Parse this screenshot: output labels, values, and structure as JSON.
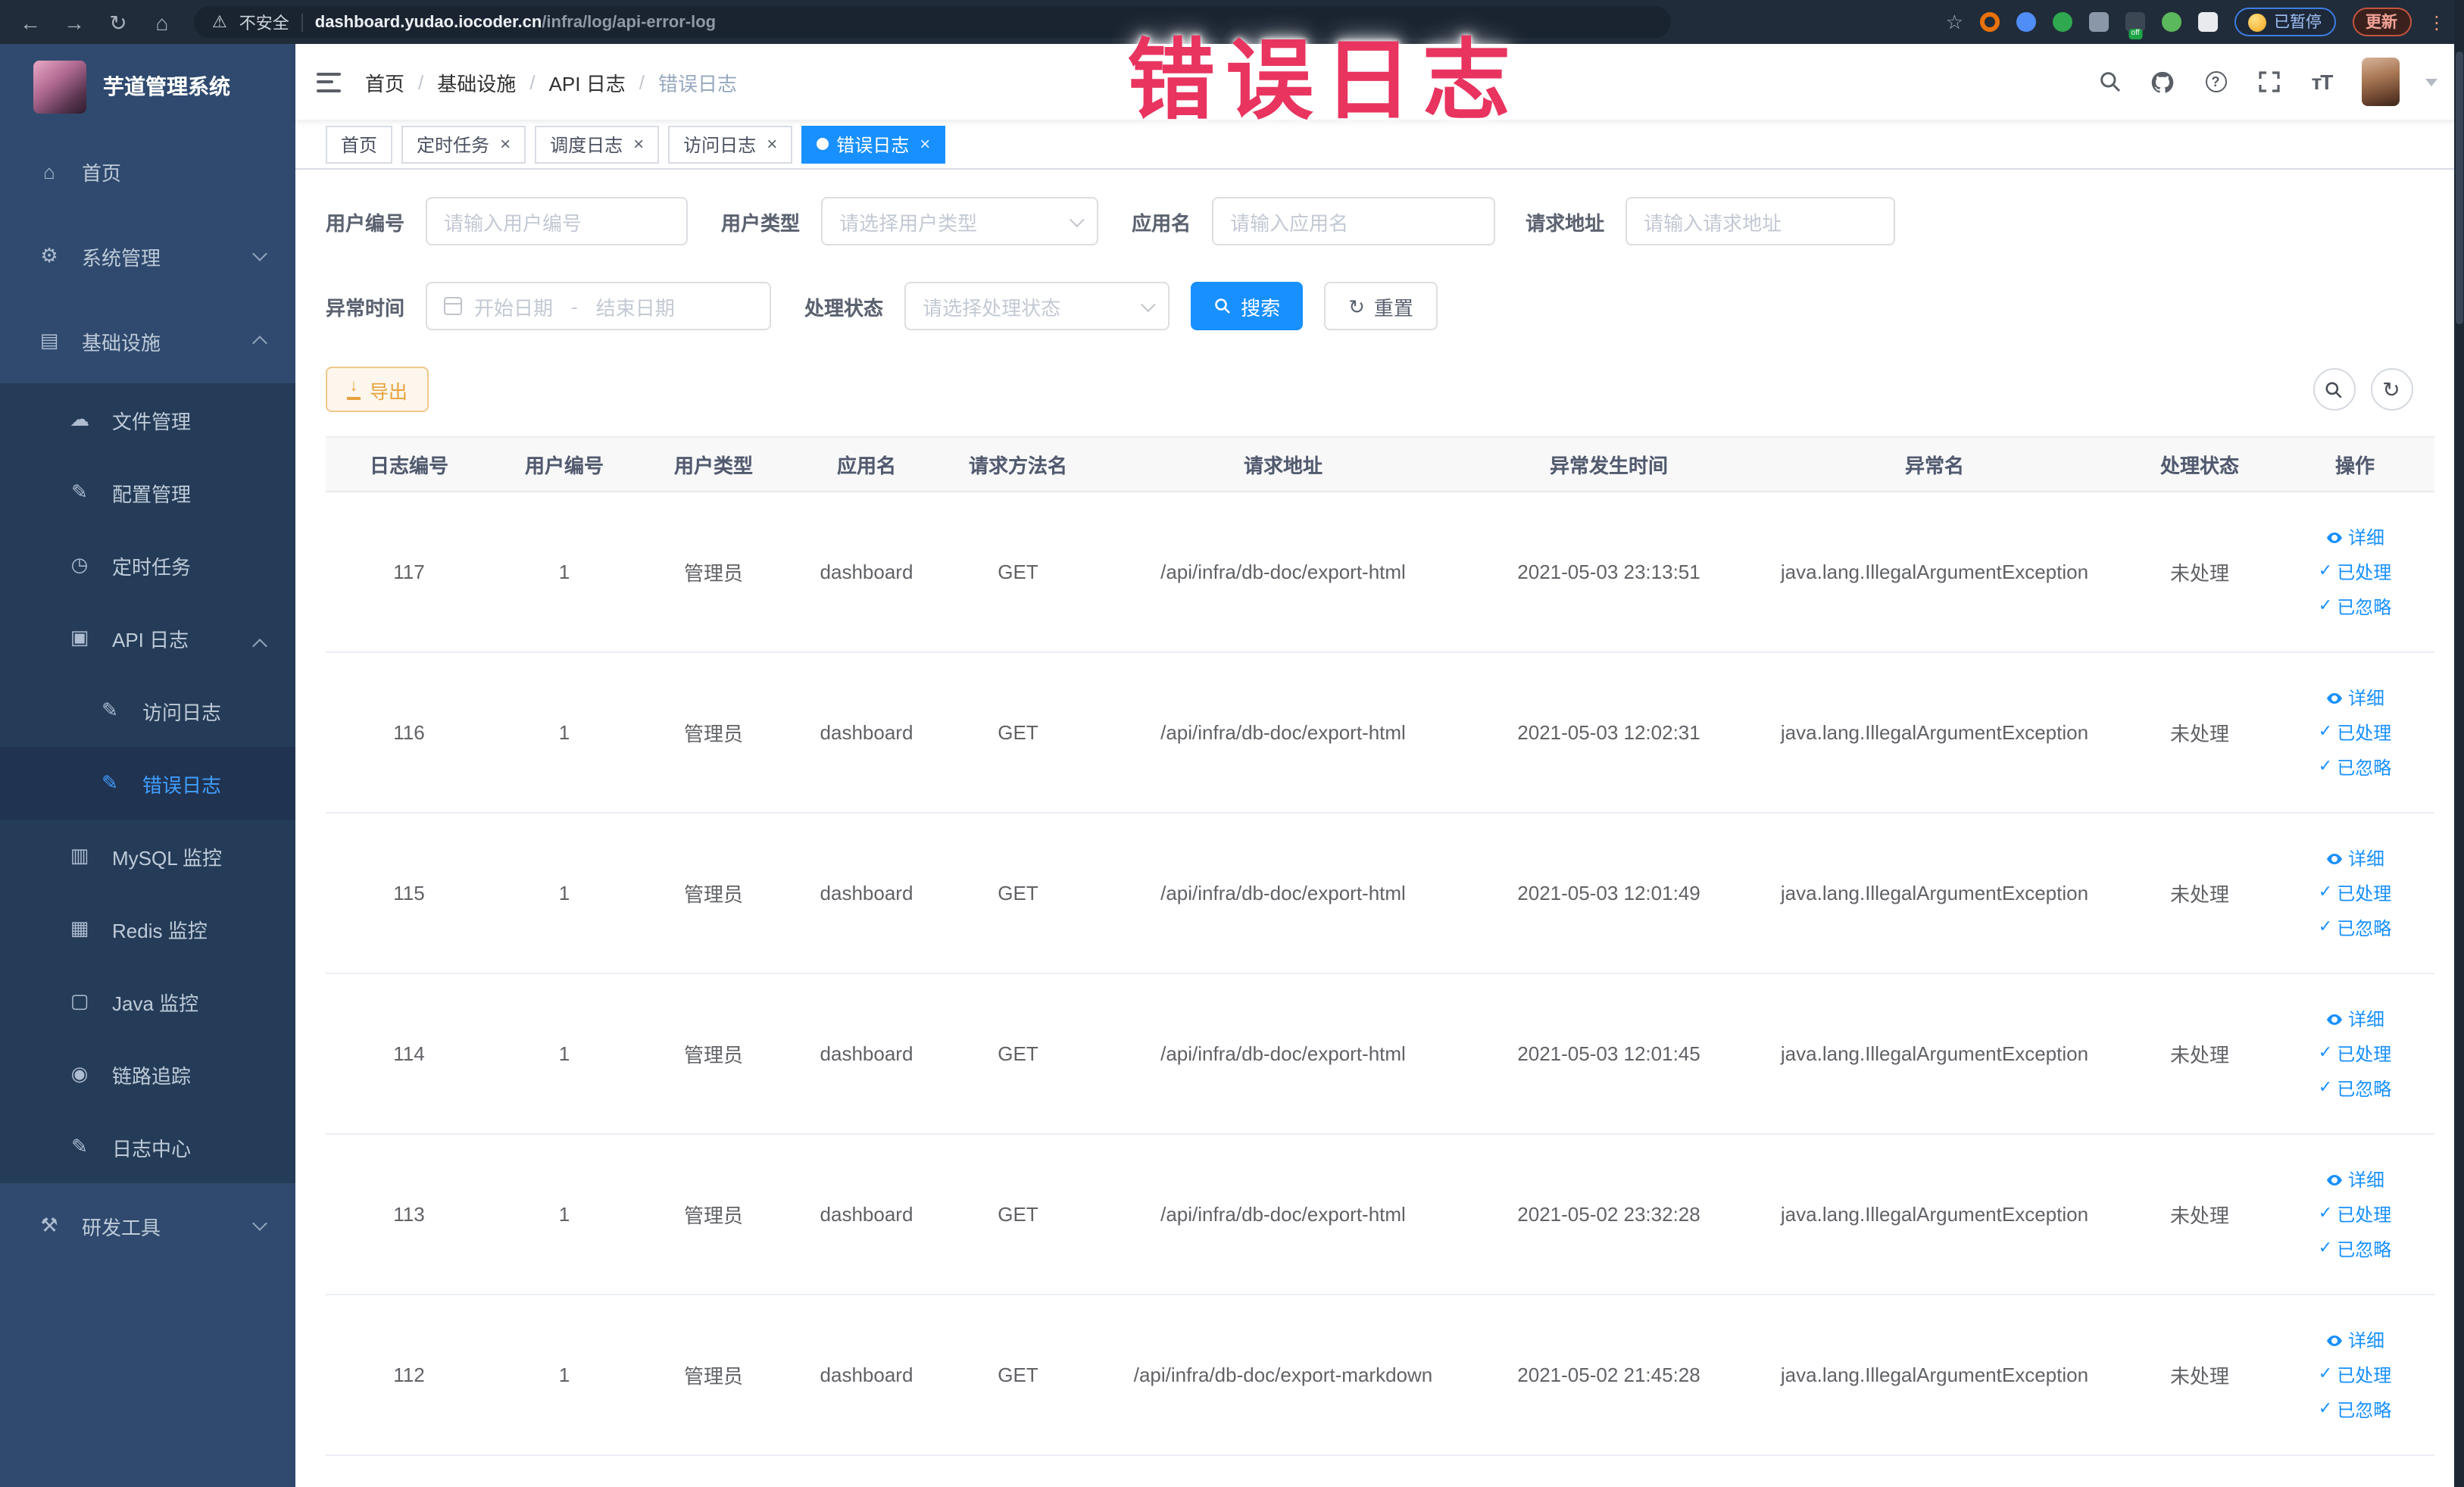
{
  "browser": {
    "security_label": "不安全",
    "url_domain": "dashboard.yudao.iocoder.cn",
    "url_path": "/infra/log/api-error-log",
    "bookmark_star": "☆",
    "extensions": [
      {
        "name": "extension-orange-ring",
        "shape": "ring",
        "color": "#e8710a"
      },
      {
        "name": "extension-blue-drop",
        "shape": "circle",
        "color": "#4f8df7"
      },
      {
        "name": "extension-green-circle",
        "shape": "circle",
        "color": "#2fa84f"
      },
      {
        "name": "extension-grid",
        "shape": "square",
        "color": "#8a97a8"
      },
      {
        "name": "extension-stripes",
        "shape": "square",
        "color": "#3c4754",
        "badge": "off"
      },
      {
        "name": "extension-green-leaf",
        "shape": "circle",
        "color": "#5cb85c"
      },
      {
        "name": "extension-white-star",
        "shape": "square",
        "color": "#e8eaed"
      }
    ],
    "paused_badge": "已暂停",
    "update_button": "更新"
  },
  "overlay": {
    "text": "错误日志",
    "color": "#e8345f"
  },
  "sidebar": {
    "logo_title": "芋道管理系统",
    "icon_glyphs": {
      "home": "⌂",
      "gear": "⚙",
      "monitor": "▤",
      "cloud": "☁",
      "edit": "✎",
      "clock": "◷",
      "log": "▣",
      "doc-edit": "✎",
      "database": "▥",
      "layers": "▦",
      "java": "▢",
      "eye": "◉",
      "tools": "⚒"
    },
    "items": [
      {
        "name": "home",
        "label": "首页",
        "level": 0,
        "icon": "home"
      },
      {
        "name": "system-management",
        "label": "系统管理",
        "level": 0,
        "icon": "gear",
        "chevron": "down"
      },
      {
        "name": "infrastructure",
        "label": "基础设施",
        "level": 0,
        "icon": "monitor",
        "chevron": "up"
      },
      {
        "name": "file-management",
        "label": "文件管理",
        "level": 1,
        "icon": "cloud"
      },
      {
        "name": "config-management",
        "label": "配置管理",
        "level": 1,
        "icon": "edit"
      },
      {
        "name": "scheduled-tasks",
        "label": "定时任务",
        "level": 1,
        "icon": "clock"
      },
      {
        "name": "api-log",
        "label": "API 日志",
        "level": 1,
        "icon": "log",
        "chevron": "up"
      },
      {
        "name": "access-log",
        "label": "访问日志",
        "level": 2,
        "icon": "doc-edit"
      },
      {
        "name": "error-log",
        "label": "错误日志",
        "level": 2,
        "icon": "doc-edit",
        "active": true
      },
      {
        "name": "mysql-monitor",
        "label": "MySQL 监控",
        "level": 1,
        "icon": "database"
      },
      {
        "name": "redis-monitor",
        "label": "Redis 监控",
        "level": 1,
        "icon": "layers"
      },
      {
        "name": "java-monitor",
        "label": "Java 监控",
        "level": 1,
        "icon": "java"
      },
      {
        "name": "trace",
        "label": "链路追踪",
        "level": 1,
        "icon": "eye"
      },
      {
        "name": "log-center",
        "label": "日志中心",
        "level": 1,
        "icon": "doc-edit"
      },
      {
        "name": "dev-tools",
        "label": "研发工具",
        "level": 0,
        "icon": "tools",
        "chevron": "down"
      }
    ]
  },
  "navbar": {
    "breadcrumb": [
      "首页",
      "基础设施",
      "API 日志",
      "错误日志"
    ],
    "separator": "/"
  },
  "tabs": [
    {
      "name": "tab-home",
      "label": "首页",
      "closable": false,
      "active": false
    },
    {
      "name": "tab-scheduled-tasks",
      "label": "定时任务",
      "closable": true,
      "active": false
    },
    {
      "name": "tab-schedule-log",
      "label": "调度日志",
      "closable": true,
      "active": false
    },
    {
      "name": "tab-access-log",
      "label": "访问日志",
      "closable": true,
      "active": false
    },
    {
      "name": "tab-error-log",
      "label": "错误日志",
      "closable": true,
      "active": true
    }
  ],
  "filters": {
    "user_id": {
      "label": "用户编号",
      "placeholder": "请输入用户编号"
    },
    "user_type": {
      "label": "用户类型",
      "placeholder": "请选择用户类型"
    },
    "app_name": {
      "label": "应用名",
      "placeholder": "请输入应用名"
    },
    "request_url": {
      "label": "请求地址",
      "placeholder": "请输入请求地址"
    },
    "exception_time": {
      "label": "异常时间",
      "start_placeholder": "开始日期",
      "separator": "-",
      "end_placeholder": "结束日期"
    },
    "process_status": {
      "label": "处理状态",
      "placeholder": "请选择处理状态"
    },
    "search_label": "搜索",
    "reset_label": "重置"
  },
  "toolbar": {
    "export_label": "导出"
  },
  "table": {
    "columns": [
      "日志编号",
      "用户编号",
      "用户类型",
      "应用名",
      "请求方法名",
      "请求地址",
      "异常发生时间",
      "异常名",
      "处理状态",
      "操作"
    ],
    "rows": [
      {
        "log_id": "117",
        "user_id": "1",
        "user_type": "管理员",
        "app_name": "dashboard",
        "method": "GET",
        "url": "/api/infra/db-doc/export-html",
        "time": "2021-05-03 23:13:51",
        "exception": "java.lang.IllegalArgumentException",
        "status": "未处理"
      },
      {
        "log_id": "116",
        "user_id": "1",
        "user_type": "管理员",
        "app_name": "dashboard",
        "method": "GET",
        "url": "/api/infra/db-doc/export-html",
        "time": "2021-05-03 12:02:31",
        "exception": "java.lang.IllegalArgumentException",
        "status": "未处理"
      },
      {
        "log_id": "115",
        "user_id": "1",
        "user_type": "管理员",
        "app_name": "dashboard",
        "method": "GET",
        "url": "/api/infra/db-doc/export-html",
        "time": "2021-05-03 12:01:49",
        "exception": "java.lang.IllegalArgumentException",
        "status": "未处理"
      },
      {
        "log_id": "114",
        "user_id": "1",
        "user_type": "管理员",
        "app_name": "dashboard",
        "method": "GET",
        "url": "/api/infra/db-doc/export-html",
        "time": "2021-05-03 12:01:45",
        "exception": "java.lang.IllegalArgumentException",
        "status": "未处理"
      },
      {
        "log_id": "113",
        "user_id": "1",
        "user_type": "管理员",
        "app_name": "dashboard",
        "method": "GET",
        "url": "/api/infra/db-doc/export-html",
        "time": "2021-05-02 23:32:28",
        "exception": "java.lang.IllegalArgumentException",
        "status": "未处理"
      },
      {
        "log_id": "112",
        "user_id": "1",
        "user_type": "管理员",
        "app_name": "dashboard",
        "method": "GET",
        "url": "/api/infra/db-doc/export-markdown",
        "time": "2021-05-02 21:45:28",
        "exception": "java.lang.IllegalArgumentException",
        "status": "未处理"
      }
    ],
    "row_actions": [
      {
        "name": "detail-link",
        "label": "详细",
        "icon": "eye"
      },
      {
        "name": "mark-processed-link",
        "label": "已处理",
        "icon": "check"
      },
      {
        "name": "mark-ignored-link",
        "label": "已忽略",
        "icon": "check"
      }
    ]
  },
  "colors": {
    "accent": "#1890ff",
    "sidebar_bg": "#2f4a6e",
    "submenu_bg": "#253c58",
    "warning": "#e6a23c"
  }
}
